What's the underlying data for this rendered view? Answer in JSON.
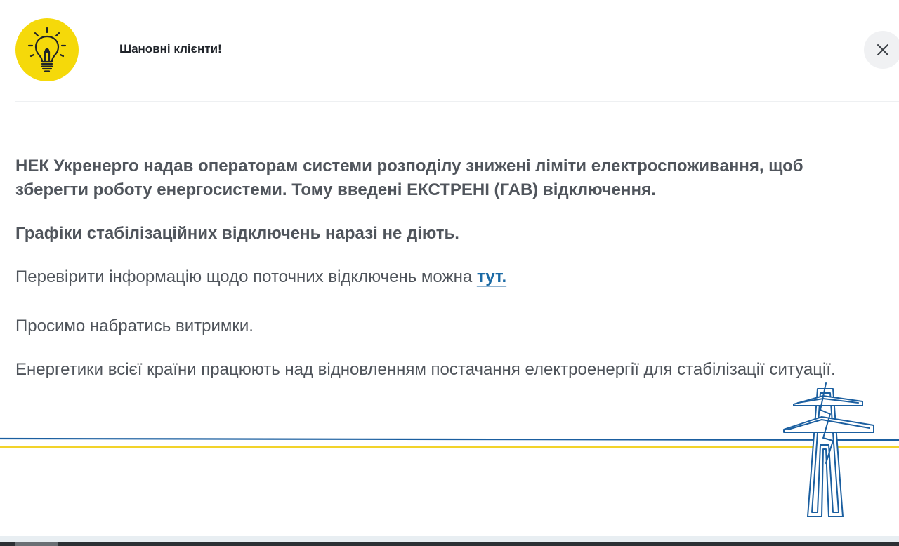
{
  "header": {
    "title": "Шановні клієнти!",
    "icon": "lightbulb-icon",
    "close_icon": "close-icon"
  },
  "body": {
    "paragraph1": "НЕК Укренерго надав операторам системи розподілу знижені ліміти електроспоживання, щоб зберегти роботу енергосистеми. Тому введені ЕКСТРЕНІ (ГАВ) відключення.",
    "paragraph2": "Графіки стабілізаційних відключень наразі не діють.",
    "paragraph3_prefix": "Перевірити інформацію щодо поточних відключень можна ",
    "paragraph3_link": "тут.",
    "paragraph4": "Просимо набратись витримки.",
    "paragraph5": "Енергетики всієї країни працюють над відновленням постачання електроенергії для стабілізації ситуації."
  },
  "decoration": {
    "pylon_icon": "power-pylon-icon"
  },
  "colors": {
    "accent_yellow": "#f5d90a",
    "line_blue": "#1b5fa0",
    "line_yellow": "#f2d32a",
    "link_blue": "#1b6aa5",
    "text_gray": "#4f545b",
    "title_dark": "#1f2329"
  }
}
